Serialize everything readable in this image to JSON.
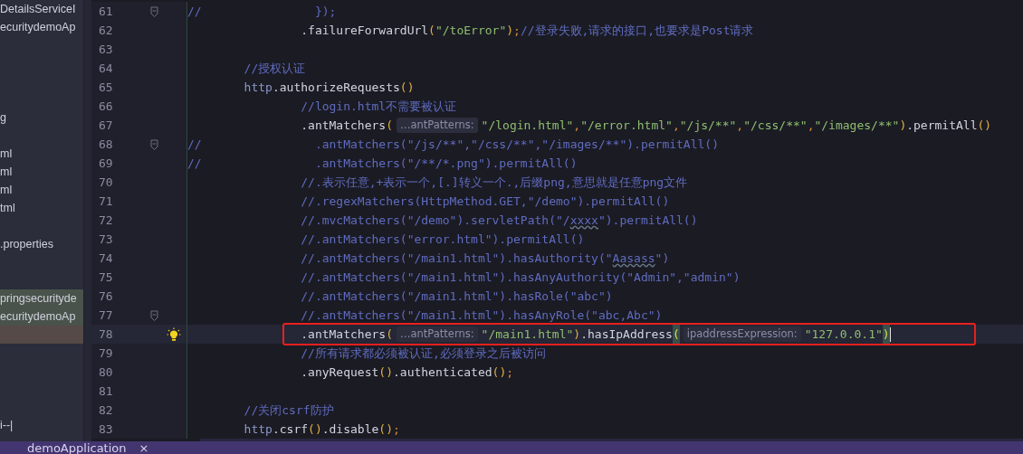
{
  "project_tree": {
    "items": [
      {
        "text": "DetailsServiceI",
        "selected": false
      },
      {
        "text": "ecuritydemoAp",
        "selected": false
      },
      {
        "text": "g",
        "selected": false
      },
      {
        "text": "ml",
        "selected": false
      },
      {
        "text": "ml",
        "selected": false
      },
      {
        "text": "ml",
        "selected": false
      },
      {
        "text": "tml",
        "selected": false
      },
      {
        "text": ".properties",
        "selected": false
      },
      {
        "text": "pringsecurityde",
        "selected": true
      },
      {
        "text": "ecuritydemoAp",
        "selected": true
      },
      {
        "text": "i--|",
        "selected": false
      }
    ]
  },
  "editor": {
    "lines": [
      {
        "number": "61",
        "fold": true,
        "current": false,
        "annotated": false,
        "tokens": [
          {
            "kind": "comment",
            "text": "//                });"
          }
        ]
      },
      {
        "number": "62",
        "fold": false,
        "current": false,
        "annotated": false,
        "tokens": [
          {
            "kind": "code",
            "text": "                .failureForwardUrl"
          },
          {
            "kind": "paren",
            "text": "("
          },
          {
            "kind": "string",
            "text": "\"/toError\""
          },
          {
            "kind": "paren",
            "text": ")"
          },
          {
            "kind": "punct",
            "text": ";"
          },
          {
            "kind": "comment",
            "text": "//登录失败,请求的接口,也要求是Post请求"
          }
        ]
      },
      {
        "number": "63",
        "fold": false,
        "current": false,
        "annotated": false
      },
      {
        "number": "64",
        "fold": false,
        "current": false,
        "annotated": false,
        "tokens": [
          {
            "kind": "comment",
            "text": "        //授权认证"
          }
        ]
      },
      {
        "number": "65",
        "fold": false,
        "current": false,
        "annotated": false,
        "tokens": [
          {
            "kind": "var",
            "text": "        http"
          },
          {
            "kind": "code",
            "text": ".authorizeRequests"
          },
          {
            "kind": "paren",
            "text": "()"
          }
        ]
      },
      {
        "number": "66",
        "fold": false,
        "current": false,
        "annotated": false,
        "tokens": [
          {
            "kind": "comment",
            "text": "                //login.html不需要被认证"
          }
        ]
      },
      {
        "number": "67",
        "fold": false,
        "current": false,
        "annotated": false,
        "tokens": [
          {
            "kind": "code",
            "text": "                .antMatchers"
          },
          {
            "kind": "paren",
            "text": "("
          },
          {
            "kind": "hint",
            "text": "…antPatterns:"
          },
          {
            "kind": "string",
            "text": "\"/login.html\""
          },
          {
            "kind": "punct",
            "text": ","
          },
          {
            "kind": "string",
            "text": "\"/error.html\""
          },
          {
            "kind": "punct",
            "text": ","
          },
          {
            "kind": "string",
            "text": "\"/js/**\""
          },
          {
            "kind": "punct",
            "text": ","
          },
          {
            "kind": "string",
            "text": "\"/css/**\""
          },
          {
            "kind": "punct",
            "text": ","
          },
          {
            "kind": "string",
            "text": "\"/images/**\""
          },
          {
            "kind": "paren",
            "text": ")"
          },
          {
            "kind": "code",
            "text": ".permitAll"
          },
          {
            "kind": "paren",
            "text": "()"
          }
        ]
      },
      {
        "number": "68",
        "fold": true,
        "current": false,
        "annotated": false,
        "tokens": [
          {
            "kind": "comment",
            "text": "//                .antMatchers(\"/js/**\",\"/css/**\",\"/images/**\").permitAll()"
          }
        ]
      },
      {
        "number": "69",
        "fold": false,
        "current": false,
        "annotated": false,
        "tokens": [
          {
            "kind": "comment",
            "text": "//                .antMatchers(\"/**/*.png\").permitAll()"
          }
        ]
      },
      {
        "number": "70",
        "fold": false,
        "current": false,
        "annotated": false,
        "tokens": [
          {
            "kind": "comment",
            "text": "                //.表示任意,+表示一个,[.]转义一个.,后缀png,意思就是任意png文件"
          }
        ]
      },
      {
        "number": "71",
        "fold": false,
        "current": false,
        "annotated": false,
        "tokens": [
          {
            "kind": "comment",
            "text": "                //.regexMatchers(HttpMethod.GET,\"/demo\").permitAll()"
          }
        ]
      },
      {
        "number": "72",
        "fold": false,
        "current": false,
        "annotated": false,
        "tokens": [
          {
            "kind": "comment",
            "text": "                //.mvcMatchers(\"/demo\").servletPath(\"/"
          },
          {
            "kind": "typo",
            "text": "xxxx"
          },
          {
            "kind": "comment",
            "text": "\").permitAll()"
          }
        ]
      },
      {
        "number": "73",
        "fold": false,
        "current": false,
        "annotated": false,
        "tokens": [
          {
            "kind": "comment",
            "text": "                //.antMatchers(\"error.html\").permitAll()"
          }
        ]
      },
      {
        "number": "74",
        "fold": false,
        "current": false,
        "annotated": false,
        "tokens": [
          {
            "kind": "comment",
            "text": "                //.antMatchers(\"/main1.html\").hasAuthority(\""
          },
          {
            "kind": "typo",
            "text": "Aasass"
          },
          {
            "kind": "comment",
            "text": "\")"
          }
        ]
      },
      {
        "number": "75",
        "fold": false,
        "current": false,
        "annotated": false,
        "tokens": [
          {
            "kind": "comment",
            "text": "                //.antMatchers(\"/main1.html\").hasAnyAuthority(\"Admin\",\"admin\")"
          }
        ]
      },
      {
        "number": "76",
        "fold": false,
        "current": false,
        "annotated": false,
        "tokens": [
          {
            "kind": "comment",
            "text": "                //.antMatchers(\"/main1.html\").hasRole(\"abc\")"
          }
        ]
      },
      {
        "number": "77",
        "fold": true,
        "current": false,
        "annotated": false,
        "tokens": [
          {
            "kind": "comment",
            "text": "                //.antMatchers(\"/main1.html\").hasAnyRole(\"abc,Abc\")"
          }
        ]
      },
      {
        "number": "78",
        "fold": false,
        "current": true,
        "annotated": true,
        "tokens": [
          {
            "kind": "code",
            "text": "                .antMatchers"
          },
          {
            "kind": "paren",
            "text": "("
          },
          {
            "kind": "hint",
            "text": "…antPatterns:"
          },
          {
            "kind": "string",
            "text": "\"/main1.html\""
          },
          {
            "kind": "paren",
            "text": ")"
          },
          {
            "kind": "code",
            "text": ".hasIpAddress"
          },
          {
            "kind": "match",
            "text": "("
          },
          {
            "kind": "hint",
            "text": "ipaddressExpression:"
          },
          {
            "kind": "string",
            "text": "\"127.0.0.1\""
          },
          {
            "kind": "match",
            "text": ")"
          }
        ]
      },
      {
        "number": "79",
        "fold": false,
        "current": false,
        "annotated": false,
        "tokens": [
          {
            "kind": "comment",
            "text": "                //所有请求都必须被认证,必须登录之后被访问"
          }
        ]
      },
      {
        "number": "80",
        "fold": false,
        "current": false,
        "annotated": false,
        "tokens": [
          {
            "kind": "code",
            "text": "                .anyRequest"
          },
          {
            "kind": "paren",
            "text": "()"
          },
          {
            "kind": "code",
            "text": ".authenticated"
          },
          {
            "kind": "paren",
            "text": "()"
          },
          {
            "kind": "punct",
            "text": ";"
          }
        ]
      },
      {
        "number": "81",
        "fold": false,
        "current": false,
        "annotated": false
      },
      {
        "number": "82",
        "fold": false,
        "current": false,
        "annotated": false,
        "tokens": [
          {
            "kind": "comment",
            "text": "        //关闭csrf防护"
          }
        ]
      },
      {
        "number": "83",
        "fold": false,
        "current": false,
        "annotated": false,
        "tokens": [
          {
            "kind": "var",
            "text": "        http"
          },
          {
            "kind": "code",
            "text": ".csrf"
          },
          {
            "kind": "paren",
            "text": "()"
          },
          {
            "kind": "code",
            "text": ".disable"
          },
          {
            "kind": "paren",
            "text": "()"
          },
          {
            "kind": "punct",
            "text": ";"
          }
        ]
      }
    ]
  },
  "bottom_tab": {
    "label": "demoApplication",
    "close": "×"
  }
}
